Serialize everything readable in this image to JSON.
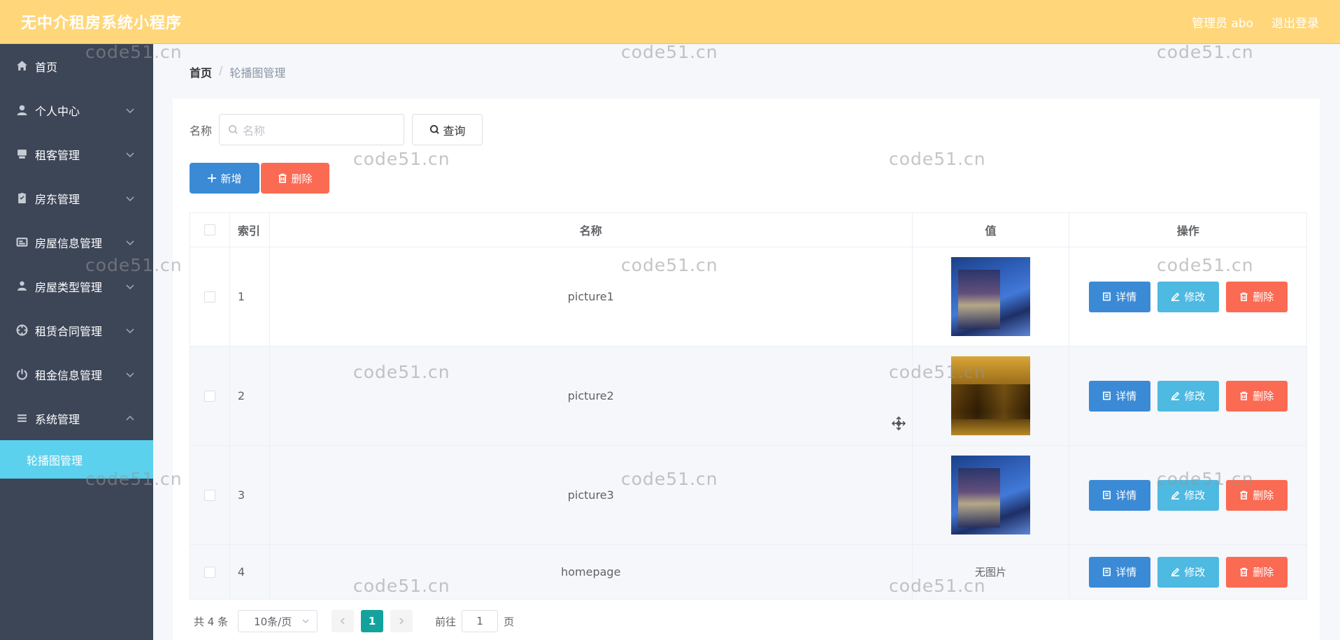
{
  "header": {
    "title": "无中介租房系统小程序",
    "admin": "管理员 abo",
    "logout": "退出登录"
  },
  "sidebar": {
    "items": [
      {
        "label": "首页",
        "icon": "home-icon"
      },
      {
        "label": "个人中心",
        "icon": "user-icon"
      },
      {
        "label": "租客管理",
        "icon": "tenant-icon"
      },
      {
        "label": "房东管理",
        "icon": "clipboard-icon"
      },
      {
        "label": "房屋信息管理",
        "icon": "card-icon"
      },
      {
        "label": "房屋类型管理",
        "icon": "person-icon"
      },
      {
        "label": "租赁合同管理",
        "icon": "globe-icon"
      },
      {
        "label": "租金信息管理",
        "icon": "power-icon"
      },
      {
        "label": "系统管理",
        "icon": "list-icon"
      }
    ],
    "active_sub": "轮播图管理"
  },
  "breadcrumb": {
    "home": "首页",
    "sep": "/",
    "current": "轮播图管理"
  },
  "search": {
    "label": "名称",
    "placeholder": "名称",
    "query_label": "查询"
  },
  "actions": {
    "add_label": "新增",
    "delete_label": "删除"
  },
  "table": {
    "headers": {
      "index": "索引",
      "name": "名称",
      "value": "值",
      "ops": "操作"
    },
    "rows": [
      {
        "index": "1",
        "name": "picture1",
        "value": "image"
      },
      {
        "index": "2",
        "name": "picture2",
        "value": "image"
      },
      {
        "index": "3",
        "name": "picture3",
        "value": "image"
      },
      {
        "index": "4",
        "name": "homepage",
        "value": "无图片"
      }
    ],
    "ops": {
      "detail": "详情",
      "edit": "修改",
      "delete": "删除"
    }
  },
  "pagination": {
    "total": "共 4 条",
    "page_size": "10条/页",
    "current": "1",
    "goto_label": "前往",
    "goto_value": "1",
    "page_suffix": "页"
  },
  "watermark": "code51.cn",
  "colors": {
    "header_bg": "#ffd77a",
    "sidebar_bg": "#3d4657",
    "active_menu": "#5bd1ee",
    "primary": "#3a8ad6",
    "info": "#4eb9e1",
    "danger": "#fb6a53",
    "pager_active": "#13a39c"
  }
}
